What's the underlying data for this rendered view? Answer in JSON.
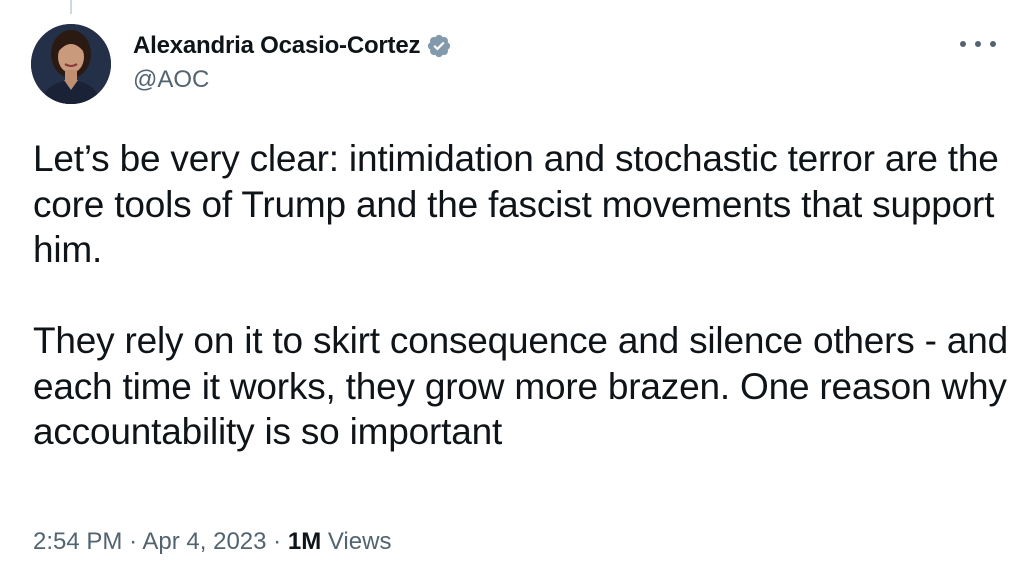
{
  "author": {
    "display_name": "Alexandria Ocasio-Cortez",
    "handle": "@AOC",
    "verified": true,
    "avatar_icon": "profile-photo-avatar"
  },
  "tweet": {
    "paragraphs": [
      "Let’s be very clear: intimidation and stochastic terror are the core tools of Trump and the fascist movements that support him.",
      "They rely on it to skirt consequence and silence others - and each time it works, they grow more brazen. One reason why accountability is so important"
    ]
  },
  "meta": {
    "time": "2:54 PM",
    "separator": "·",
    "date": "Apr 4, 2023",
    "views_count": "1M",
    "views_label": "Views"
  },
  "colors": {
    "text_primary": "#0f1419",
    "text_secondary": "#536471",
    "verified_badge": "#829aab",
    "thread_line": "#cfd9de"
  }
}
